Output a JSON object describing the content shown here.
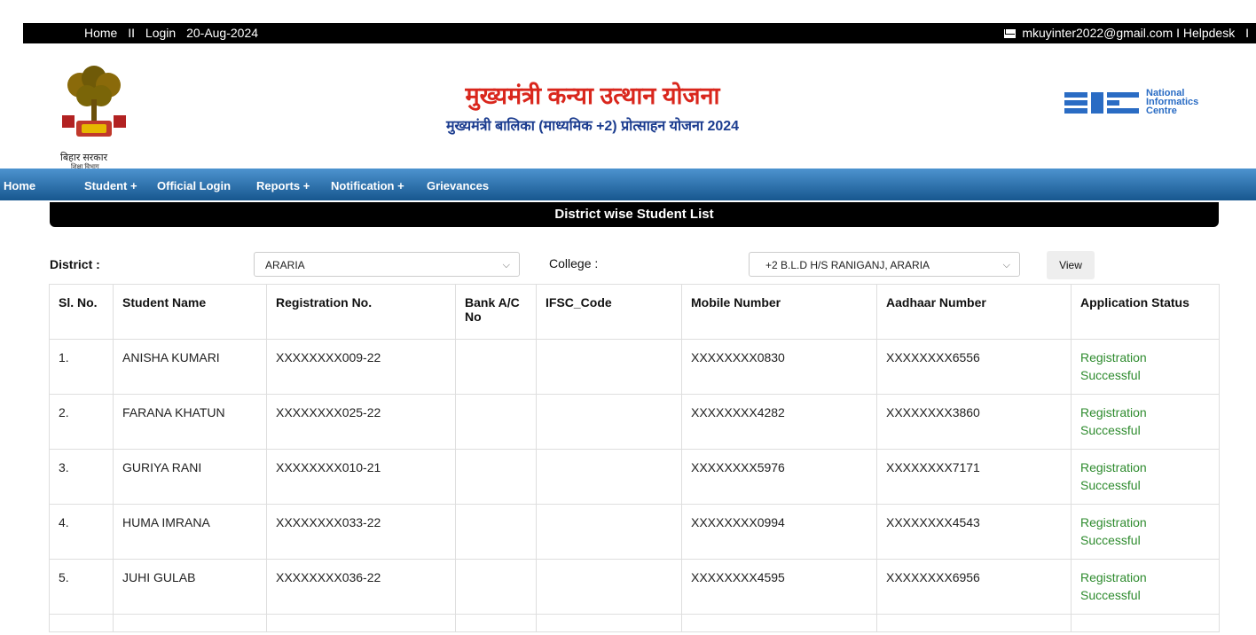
{
  "topbar": {
    "home": "Home",
    "sep": "II",
    "login": "Login",
    "date": "20-Aug-2024",
    "email": "mkuyinter2022@gmail.com",
    "helpdesk": "I Helpdesk",
    "end": "I"
  },
  "header": {
    "emblem_caption": "बिहार सरकार",
    "emblem_subcaption": "शिक्षा विभाग",
    "title": "मुख्यमंत्री कन्या उत्थान योजना",
    "subtitle": "मुख्यमंत्री बालिका (माध्यमिक +2) प्रोत्साहन योजना 2024",
    "nic_line1": "National",
    "nic_line2": "Informatics",
    "nic_line3": "Centre",
    "nic_logo": "NIC"
  },
  "nav": {
    "home": "Home",
    "student": "Student +",
    "official_login": "Official Login",
    "reports": "Reports +",
    "notification": "Notification +",
    "grievances": "Grievances"
  },
  "panel": {
    "title": "District wise Student List",
    "district_label": "District :",
    "district_value": "ARARIA",
    "college_label": "College :",
    "college_value": "+2 B.L.D H/S RANIGANJ, ARARIA",
    "view_button": "View"
  },
  "table": {
    "headers": [
      "Sl. No.",
      "Student Name",
      "Registration No.",
      "Bank A/C No",
      "IFSC_Code",
      "Mobile Number",
      "Aadhaar Number",
      "Application Status"
    ],
    "rows": [
      {
        "sl": "1.",
        "name": "ANISHA KUMARI",
        "reg": "XXXXXXXX009-22",
        "bank": "",
        "ifsc": "",
        "mobile": "XXXXXXXX0830",
        "aadhaar": "XXXXXXXX6556",
        "status1": "Registration",
        "status2": "Successful"
      },
      {
        "sl": "2.",
        "name": "FARANA KHATUN",
        "reg": "XXXXXXXX025-22",
        "bank": "",
        "ifsc": "",
        "mobile": "XXXXXXXX4282",
        "aadhaar": "XXXXXXXX3860",
        "status1": "Registration",
        "status2": "Successful"
      },
      {
        "sl": "3.",
        "name": "GURIYA RANI",
        "reg": "XXXXXXXX010-21",
        "bank": "",
        "ifsc": "",
        "mobile": "XXXXXXXX5976",
        "aadhaar": "XXXXXXXX7171",
        "status1": "Registration",
        "status2": "Successful"
      },
      {
        "sl": "4.",
        "name": "HUMA IMRANA",
        "reg": "XXXXXXXX033-22",
        "bank": "",
        "ifsc": "",
        "mobile": "XXXXXXXX0994",
        "aadhaar": "XXXXXXXX4543",
        "status1": "Registration",
        "status2": "Successful"
      },
      {
        "sl": "5.",
        "name": "JUHI GULAB",
        "reg": "XXXXXXXX036-22",
        "bank": "",
        "ifsc": "",
        "mobile": "XXXXXXXX4595",
        "aadhaar": "XXXXXXXX6956",
        "status1": "Registration",
        "status2": "Successful"
      }
    ]
  },
  "colors": {
    "title_red": "#d9261c",
    "subtitle_blue": "#1b3c8f",
    "status_green": "#2e8b2e",
    "nav_blue": "#2a6aa5"
  },
  "icons": [
    "mail-icon",
    "bihar-emblem-logo",
    "nic-logo",
    "chevron-down-icon"
  ]
}
